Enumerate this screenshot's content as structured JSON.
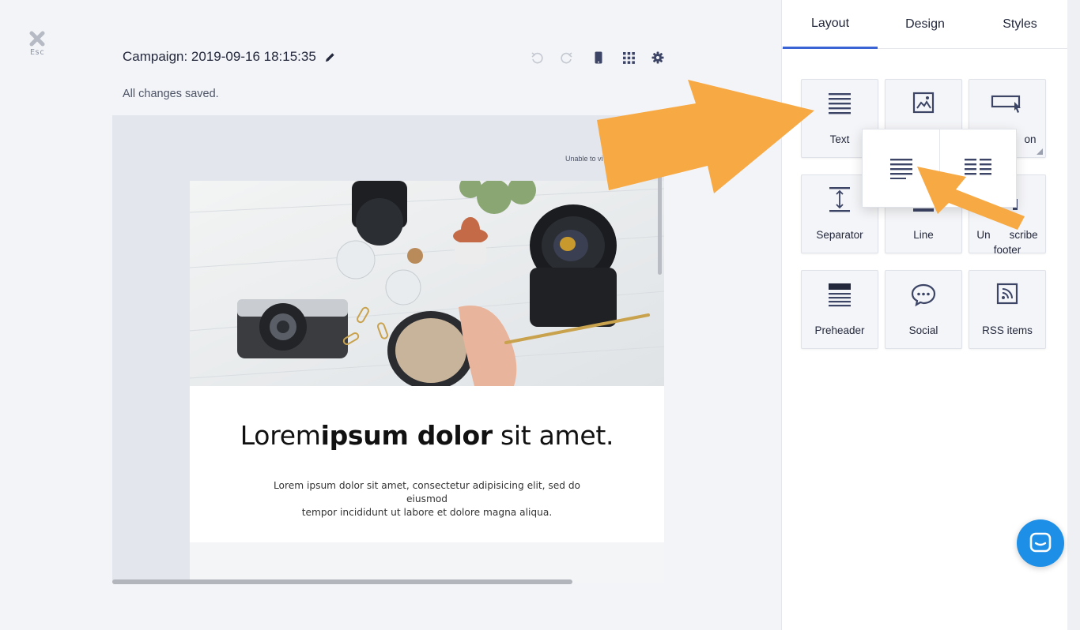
{
  "close": {
    "label": "Esc"
  },
  "campaign": {
    "title": "Campaign: 2019-09-16 18:15:35",
    "status": "All changes saved."
  },
  "preview": {
    "unable_text": "Unable to vi",
    "headline_light": "Lorem",
    "headline_bold": "ipsum dolor",
    "headline_rest": " sit amet.",
    "body_line1": "Lorem ipsum dolor sit amet, consectetur adipisicing elit, sed do eiusmod",
    "body_line2": "tempor incididunt ut labore et dolore magna aliqua."
  },
  "panel": {
    "tabs": [
      {
        "label": "Layout",
        "active": true
      },
      {
        "label": "Design",
        "active": false
      },
      {
        "label": "Styles",
        "active": false
      }
    ],
    "blocks": [
      {
        "label": "Text",
        "icon": "text-lines-icon"
      },
      {
        "label": "",
        "icon": "image-icon"
      },
      {
        "label": "on",
        "icon": "button-cursor-icon"
      },
      {
        "label": "Separator",
        "icon": "separator-icon"
      },
      {
        "label": "Line",
        "icon": "line-icon"
      },
      {
        "label": "Un",
        "label_b": "scribe",
        "label2": "footer",
        "icon": "unsubscribe-icon"
      },
      {
        "label": "Preheader",
        "icon": "preheader-icon"
      },
      {
        "label": "Social",
        "icon": "chat-bubble-icon"
      },
      {
        "label": "RSS items",
        "icon": "rss-icon"
      }
    ],
    "text_variants": [
      "single-column-text-icon",
      "two-column-text-icon"
    ]
  },
  "colors": {
    "accent": "#3a63d6",
    "arrow": "#f7a944",
    "chat": "#1d8fe6",
    "icon": "#3d4566"
  }
}
